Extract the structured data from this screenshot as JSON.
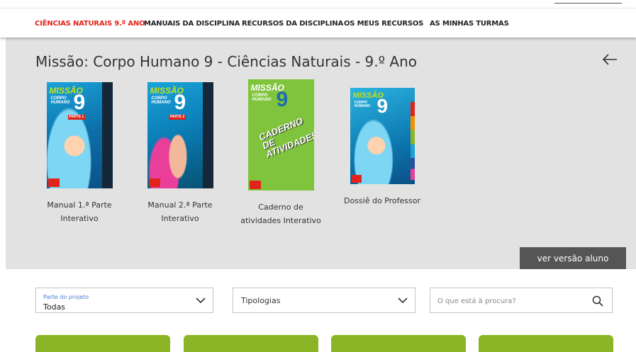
{
  "nav": {
    "items": [
      {
        "label": "CIÊNCIAS NATURAIS 9.º ANO",
        "active": true
      },
      {
        "label": "MANUAIS DA DISCIPLINA"
      },
      {
        "label": "RECURSOS DA DISCIPLINA"
      },
      {
        "label": "OS MEUS RECURSOS"
      },
      {
        "label": "AS MINHAS TURMAS"
      }
    ]
  },
  "project": {
    "title": "Missão: Corpo Humano 9 - Ciências Naturais - 9.º Ano",
    "back_icon": "arrow-left-icon",
    "student_button": "ver versão aluno"
  },
  "books": [
    {
      "label": "Manual 1.ª Parte Interativo",
      "cover_brand": "MISSÃO",
      "cover_sub": "CORPO HUMANO",
      "cover_number": "9",
      "cover_part": "PARTE 1"
    },
    {
      "label": "Manual 2.ª Parte Interativo",
      "cover_brand": "MISSÃO",
      "cover_sub": "CORPO HUMANO",
      "cover_number": "9",
      "cover_part": "PARTE 2"
    },
    {
      "label": "Caderno de atividades Interativo",
      "cover_brand": "MISSÃO",
      "cover_sub": "CORPO HUMANO",
      "cover_number": "9",
      "cover_title": "CADERNO DE ATIVIDADES"
    },
    {
      "label": "Dossiê do Professor",
      "cover_brand": "MISSÃO",
      "cover_sub": "CORPO HUMANO",
      "cover_number": "9"
    }
  ],
  "filters": {
    "part": {
      "label": "Parte do projeto",
      "value": "Todas"
    },
    "typology": {
      "value": "Tipologias"
    },
    "search": {
      "placeholder": "O que está à procura?"
    }
  },
  "colors": {
    "accent": "#e2231a",
    "green": "#8bb526",
    "hero_bg": "#e2e2e2",
    "dark_button": "#555555"
  }
}
